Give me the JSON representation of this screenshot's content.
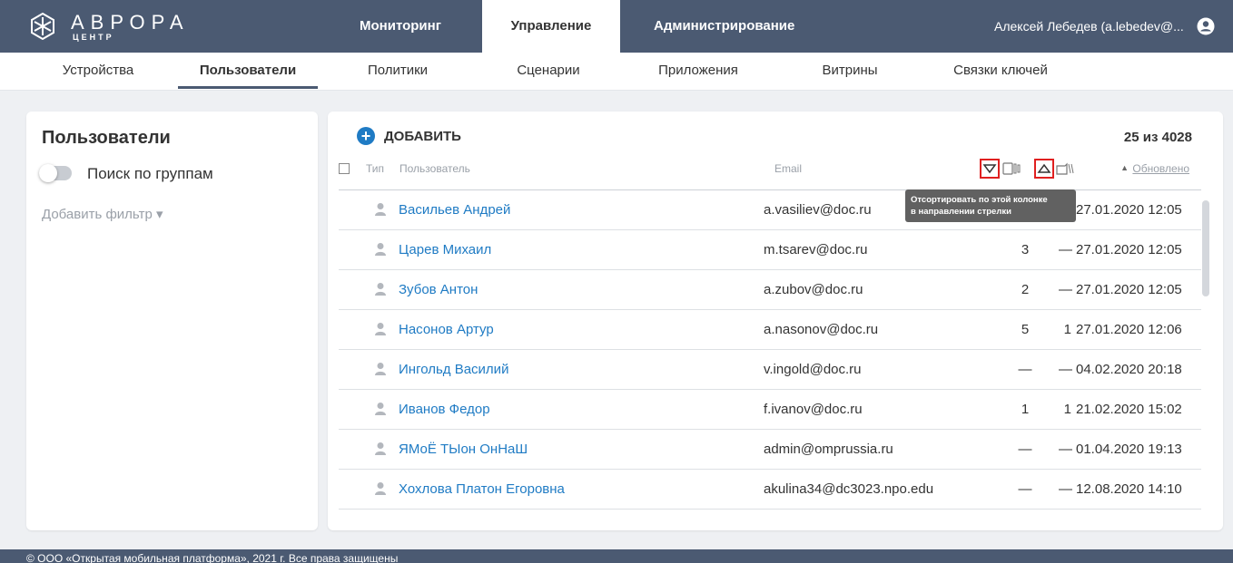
{
  "app": {
    "logo_text": "АВРОРА",
    "logo_sub": "ЦЕНТР"
  },
  "topnav": {
    "tabs": [
      {
        "label": "Мониторинг"
      },
      {
        "label": "Управление"
      },
      {
        "label": "Администрирование"
      }
    ],
    "user": "Алексей Лебедев (a.lebedev@..."
  },
  "subnav": {
    "items": [
      {
        "label": "Устройства"
      },
      {
        "label": "Пользователи"
      },
      {
        "label": "Политики"
      },
      {
        "label": "Сценарии"
      },
      {
        "label": "Приложения"
      },
      {
        "label": "Витрины"
      },
      {
        "label": "Связки ключей"
      }
    ]
  },
  "sidebar": {
    "title": "Пользователи",
    "group_search_label": "Поиск по группам",
    "add_filter": "Добавить фильтр ▾"
  },
  "table": {
    "add_label": "ДОБАВИТЬ",
    "count": "25 из 4028",
    "headers": {
      "type": "Тип",
      "user": "Пользователь",
      "email": "Email",
      "updated": "Обновлено"
    },
    "tooltip_line1": "Отсортировать по этой колонке",
    "tooltip_line2": "в направлении стрелки",
    "rows": [
      {
        "name": "Васильев Андрей",
        "email": "a.vasiliev@doc.ru",
        "devices": "",
        "keys": "",
        "updated": "27.01.2020 12:05"
      },
      {
        "name": "Царев Михаил",
        "email": "m.tsarev@doc.ru",
        "devices": "3",
        "keys": "—",
        "updated": "27.01.2020 12:05"
      },
      {
        "name": "Зубов Антон",
        "email": "a.zubov@doc.ru",
        "devices": "2",
        "keys": "—",
        "updated": "27.01.2020 12:05"
      },
      {
        "name": "Насонов Артур",
        "email": "a.nasonov@doc.ru",
        "devices": "5",
        "keys": "1",
        "updated": "27.01.2020 12:06"
      },
      {
        "name": "Ингольд Василий",
        "email": "v.ingold@doc.ru",
        "devices": "—",
        "keys": "—",
        "updated": "04.02.2020 20:18"
      },
      {
        "name": "Иванов Федор",
        "email": "f.ivanov@doc.ru",
        "devices": "1",
        "keys": "1",
        "updated": "21.02.2020 15:02"
      },
      {
        "name": "ЯМоЁ ТЫон ОнНаШ",
        "email": "admin@omprussia.ru",
        "devices": "—",
        "keys": "—",
        "updated": "01.04.2020 19:13"
      },
      {
        "name": "Хохлова Платон Егоровна",
        "email": "akulina34@dc3023.npo.edu",
        "devices": "—",
        "keys": "—",
        "updated": "12.08.2020 14:10"
      }
    ]
  },
  "footer": {
    "text": "© ООО «Открытая мобильная платформа», 2021 г. Все права защищены"
  },
  "colors": {
    "header_bg": "#4b5a72",
    "link": "#1f7bc4",
    "highlight": "#e02020",
    "page_bg": "#eef0f3"
  }
}
